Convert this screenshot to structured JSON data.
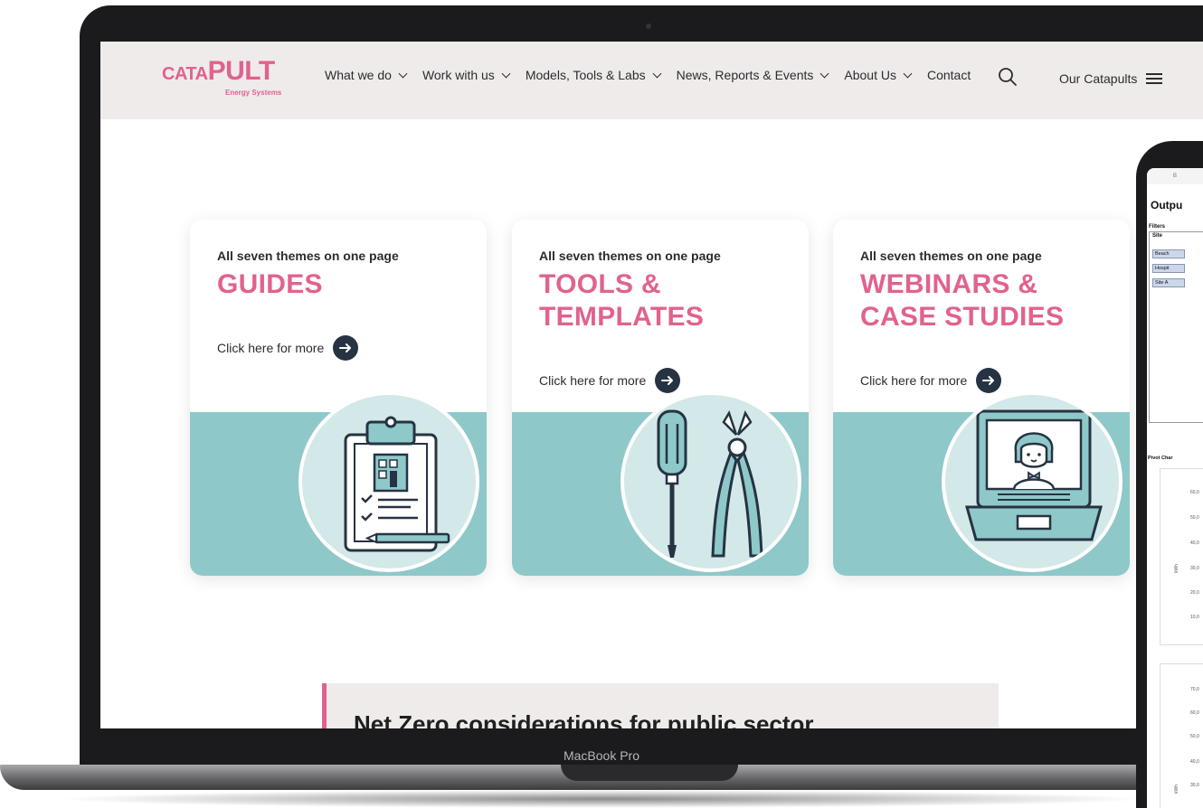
{
  "device": {
    "laptop_label": "MacBook Pro"
  },
  "header": {
    "logo": {
      "prefix": "CATA",
      "main": "PULT",
      "subtitle": "Energy Systems"
    },
    "nav": [
      {
        "label": "What we do",
        "has_dropdown": true
      },
      {
        "label": "Work with us",
        "has_dropdown": true
      },
      {
        "label": "Models, Tools & Labs",
        "has_dropdown": true
      },
      {
        "label": "News, Reports & Events",
        "has_dropdown": true
      },
      {
        "label": "About Us",
        "has_dropdown": true
      },
      {
        "label": "Contact",
        "has_dropdown": false
      }
    ],
    "search_icon": "search-icon",
    "our_catapults": "Our Catapults",
    "menu_icon": "hamburger-icon"
  },
  "cards": [
    {
      "kicker": "All seven themes on one page",
      "title_lines": [
        "GUIDES"
      ],
      "cta": "Click here for more",
      "illustration": "clipboard-icon"
    },
    {
      "kicker": "All seven themes on one page",
      "title_lines": [
        "TOOLS &",
        "TEMPLATES"
      ],
      "cta": "Click here for more",
      "illustration": "tools-icon"
    },
    {
      "kicker": "All seven themes on one page",
      "title_lines": [
        "WEBINARS &",
        "CASE STUDIES"
      ],
      "cta": "Click here for more",
      "illustration": "laptop-presenter-icon"
    }
  ],
  "article": {
    "title": "Net Zero considerations for public sector"
  },
  "phone": {
    "top_bar": "B",
    "title": "Outpu",
    "filters_label": "Filters",
    "site_label": "Site",
    "chips": [
      "Beach",
      "Hospit",
      "Site A"
    ],
    "pivot_label": "Pivot Char",
    "chart1_ticks": [
      "60,0",
      "50,0",
      "40,0",
      "30,0",
      "20,0",
      "10,0"
    ],
    "chart2_ticks": [
      "70,0",
      "60,0",
      "50,0",
      "40,0",
      "30,0"
    ],
    "y_unit": "kWh"
  },
  "colors": {
    "brand_pink": "#e0628f",
    "teal": "#8fc8c9",
    "header_bg": "#efebeb",
    "dark": "#263342"
  }
}
